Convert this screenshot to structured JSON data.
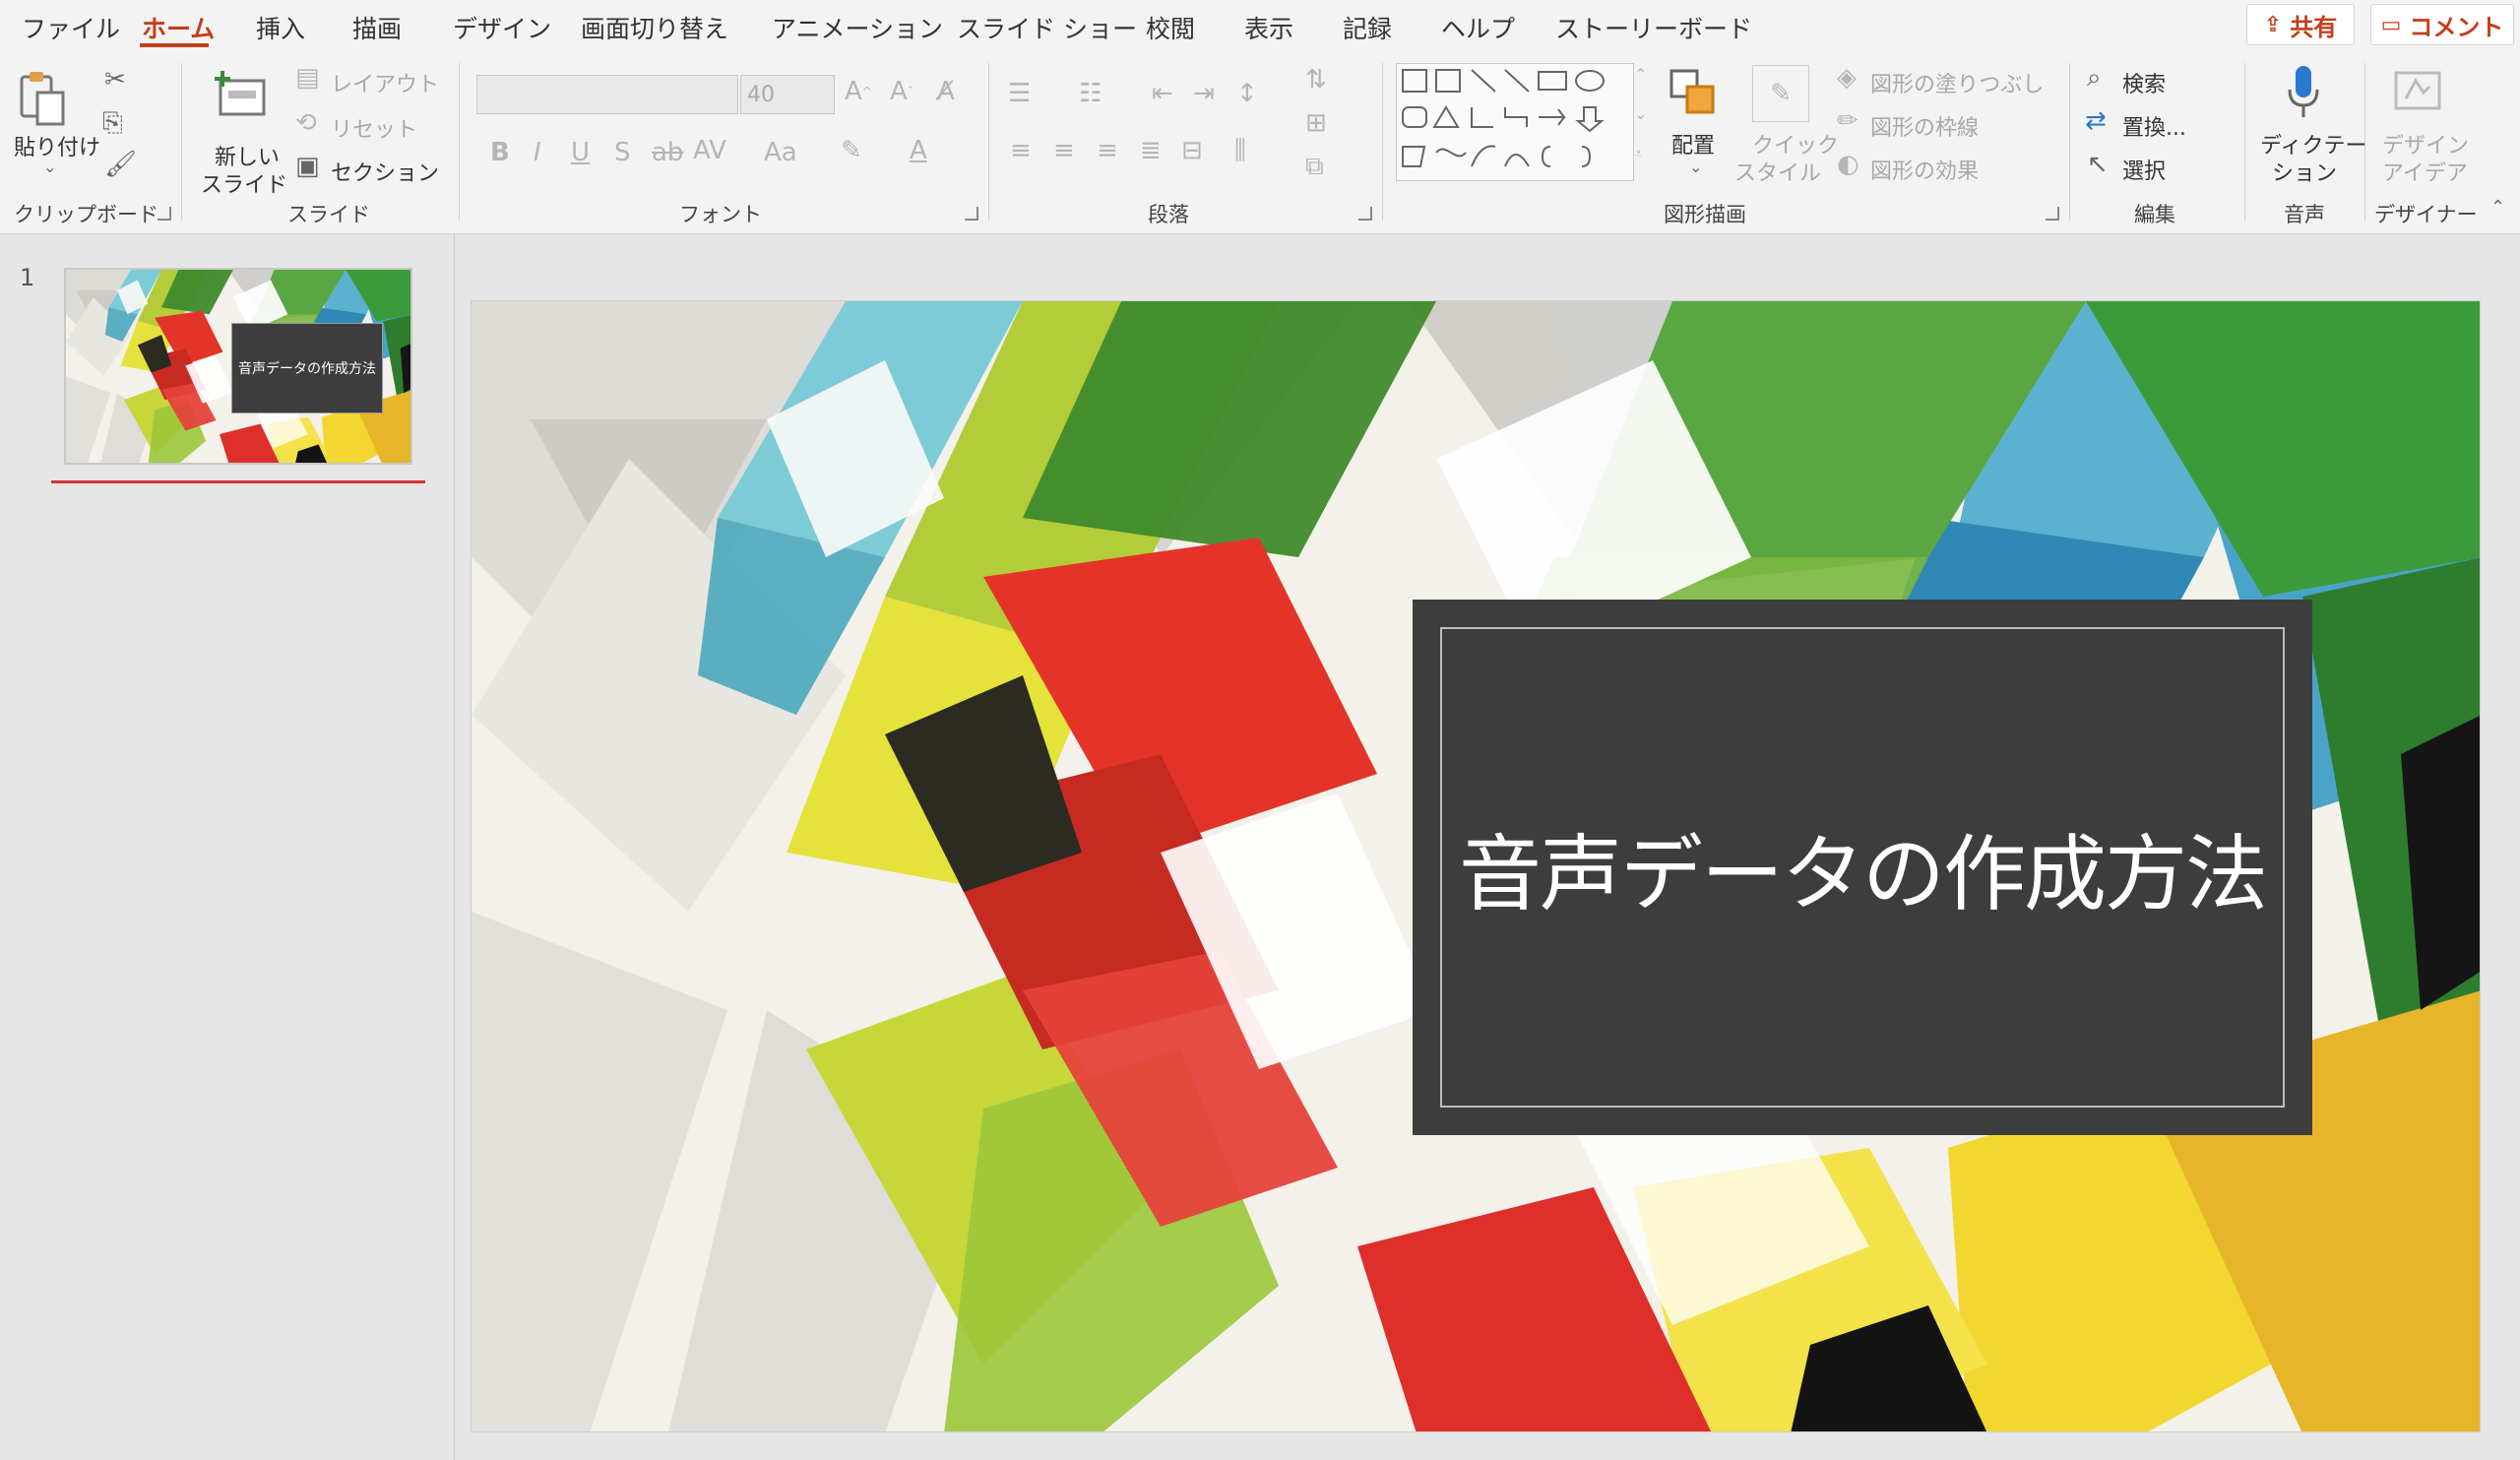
{
  "menu": {
    "items": [
      "ファイル",
      "ホーム",
      "挿入",
      "描画",
      "デザイン",
      "画面切り替え",
      "アニメーション",
      "スライド ショー",
      "校閲",
      "表示",
      "記録",
      "ヘルプ",
      "ストーリーボード"
    ],
    "active": "ホーム",
    "share_label": "共有",
    "comment_label": "コメント"
  },
  "ribbon": {
    "clipboard": {
      "paste_label": "貼り付け",
      "group_label": "クリップボード"
    },
    "slides": {
      "new_slide_label1": "新しい",
      "new_slide_label2": "スライド",
      "layout_label": "レイアウト",
      "reset_label": "リセット",
      "section_label": "セクション",
      "group_label": "スライド"
    },
    "font": {
      "font_name": "",
      "font_size": "40",
      "group_label": "フォント"
    },
    "paragraph": {
      "group_label": "段落"
    },
    "drawing": {
      "arrange_label": "配置",
      "quick_style_label1": "クイック",
      "quick_style_label2": "スタイル",
      "fill_label": "図形の塗りつぶし",
      "outline_label": "図形の枠線",
      "effects_label": "図形の効果",
      "group_label": "図形描画"
    },
    "editing": {
      "find_label": "検索",
      "replace_label": "置換...",
      "select_label": "選択",
      "group_label": "編集"
    },
    "voice": {
      "dictate_label1": "ディクテー",
      "dictate_label2": "ション",
      "group_label": "音声"
    },
    "designer": {
      "design_ideas_label1": "デザイン",
      "design_ideas_label2": "アイデア",
      "group_label": "デザイナー"
    }
  },
  "thumbnails": [
    {
      "number": "1",
      "title": "音声データの作成方法"
    }
  ],
  "slide": {
    "title": "音声データの作成方法"
  },
  "colors": {
    "accent": "#c43e1c",
    "title_box": "#3d3d3d"
  }
}
